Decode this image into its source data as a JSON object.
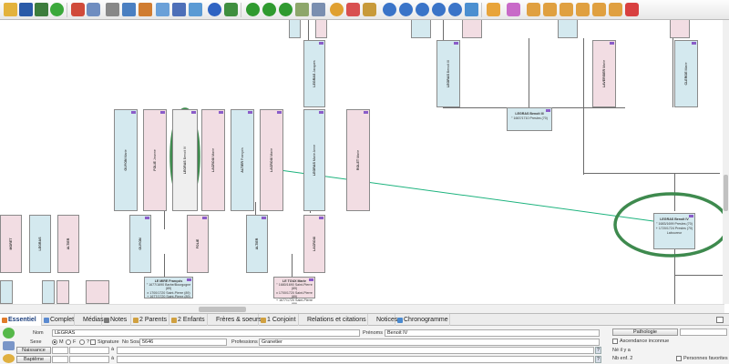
{
  "toolbar": {
    "icons": [
      "folder-open-icon",
      "save-icon",
      "tree-icon",
      "refresh-icon",
      "undo-icon",
      "redo-icon",
      "print-icon",
      "settings-icon",
      "export-icon",
      "list-icon",
      "help-icon",
      "person-tree-icon",
      "number-1-icon",
      "number-2-icon",
      "number-3-icon",
      "bank-icon",
      "printer-icon",
      "search-icon",
      "filter-icon",
      "zoom-in-icon",
      "zoom-out-icon",
      "zoom-fit-icon",
      "zoom-icon",
      "fullscreen-icon",
      "person-icon",
      "filter-down-icon",
      "add-parent-icon",
      "add-child-icon",
      "add-spouse-icon",
      "add-sibling-icon",
      "add-person-icon",
      "delete-person-icon"
    ],
    "accent": "#2e9b2e"
  },
  "tree": {
    "cards_vertical": [
      {
        "name": "",
        "lines": [
          ""
        ],
        "sex": "m"
      },
      {
        "name": "",
        "lines": [
          ""
        ],
        "sex": "f"
      },
      {
        "name": "LEGRAS",
        "lines": [
          "Jacques",
          "°",
          "+"
        ],
        "sex": "m"
      },
      {
        "name": "LAVERSIER",
        "lines": [
          "Marie",
          "°",
          "+"
        ],
        "sex": "f"
      },
      {
        "name": "CLERGE",
        "lines": [
          "Marie",
          "°",
          "+"
        ],
        "sex": "f"
      },
      {
        "name": "LEGRAS",
        "lines": [
          "Benoit III"
        ],
        "sex": "m"
      },
      {
        "name": "LEGRAS",
        "lines": [
          "Nicolas"
        ],
        "sex": "m"
      },
      {
        "name": "MORET",
        "lines": [
          "Marie"
        ],
        "sex": "f"
      },
      {
        "name": "GUYON",
        "lines": [
          "Marie"
        ],
        "sex": "m"
      },
      {
        "name": "LEGRAS",
        "lines": [
          "Benoit IV"
        ],
        "sex": "g"
      },
      {
        "name": "FOLIE",
        "lines": [
          "Jeanne"
        ],
        "sex": "f"
      },
      {
        "name": "ALTIER",
        "lines": [
          "François"
        ],
        "sex": "m"
      },
      {
        "name": "LACROIX",
        "lines": [
          "Marie"
        ],
        "sex": "f"
      },
      {
        "name": "LEGRAS",
        "lines": [
          "Marie Anne"
        ],
        "sex": "m"
      },
      {
        "name": "ROLET",
        "lines": [
          "Marie"
        ],
        "sex": "f"
      }
    ],
    "card_top_center": {
      "name": "LEGRAS Benoit III",
      "lines": [
        "° 1667/1710 Presles (70)"
      ]
    },
    "card_right_main": {
      "name": "LEGRAS Benoit IV",
      "lines": [
        "° 1683/1699 Presles (70)",
        "+ 1720/1724 Presles (70)",
        "Laboureur"
      ]
    },
    "card_bottom_left": {
      "name": "LE MIRE François",
      "lines": [
        "° 1677/1690 Barbe/Bourgogne (89)",
        "x 1700/1720 Saint-Pierre (89)",
        "+ 1677/1720 Saint-Pierre (89)"
      ]
    },
    "card_bottom_mid": {
      "name": "LE TOUX Marie",
      "lines": [
        "° 1680/1690 Saint-Pierre (89)",
        "x 1700/1720 Saint-Pierre (89)",
        "+ 1677/1720 Saint-Pierre (89)"
      ]
    }
  },
  "tabs": [
    {
      "label": "Essentiel",
      "active": true
    },
    {
      "label": "Complet"
    },
    {
      "label": "Médias"
    },
    {
      "label": "Notes"
    },
    {
      "label": "2 Parents"
    },
    {
      "label": "2 Enfants"
    },
    {
      "label": "Frères & soeurs"
    },
    {
      "label": "1 Conjoint"
    },
    {
      "label": "Relations et citations"
    },
    {
      "label": "Notices"
    },
    {
      "label": "Chronogramme"
    }
  ],
  "form": {
    "nom_label": "Nom",
    "nom_value": "LEGRAS",
    "prenoms_label": "Prénoms",
    "prenoms_value": "Benoit IV",
    "sexe_label": "Sexe",
    "sexe_m": "M",
    "sexe_f": "F",
    "sexe_q": "?",
    "signature_label": "Signature",
    "sosa_label": "No Sosa",
    "sosa_value": "5646",
    "profession_label": "Professions",
    "profession_value": "Granetier",
    "naissance_label": "Naissance",
    "bapteme_label": "Baptême",
    "pathologie_label": "Pathologie",
    "ascendance_label": "Ascendance inconnue",
    "age_label": "Né il y a",
    "nb_enf_label": "Nb enf. 2",
    "favorites_label": "Personnes favorites",
    "q": "?"
  }
}
